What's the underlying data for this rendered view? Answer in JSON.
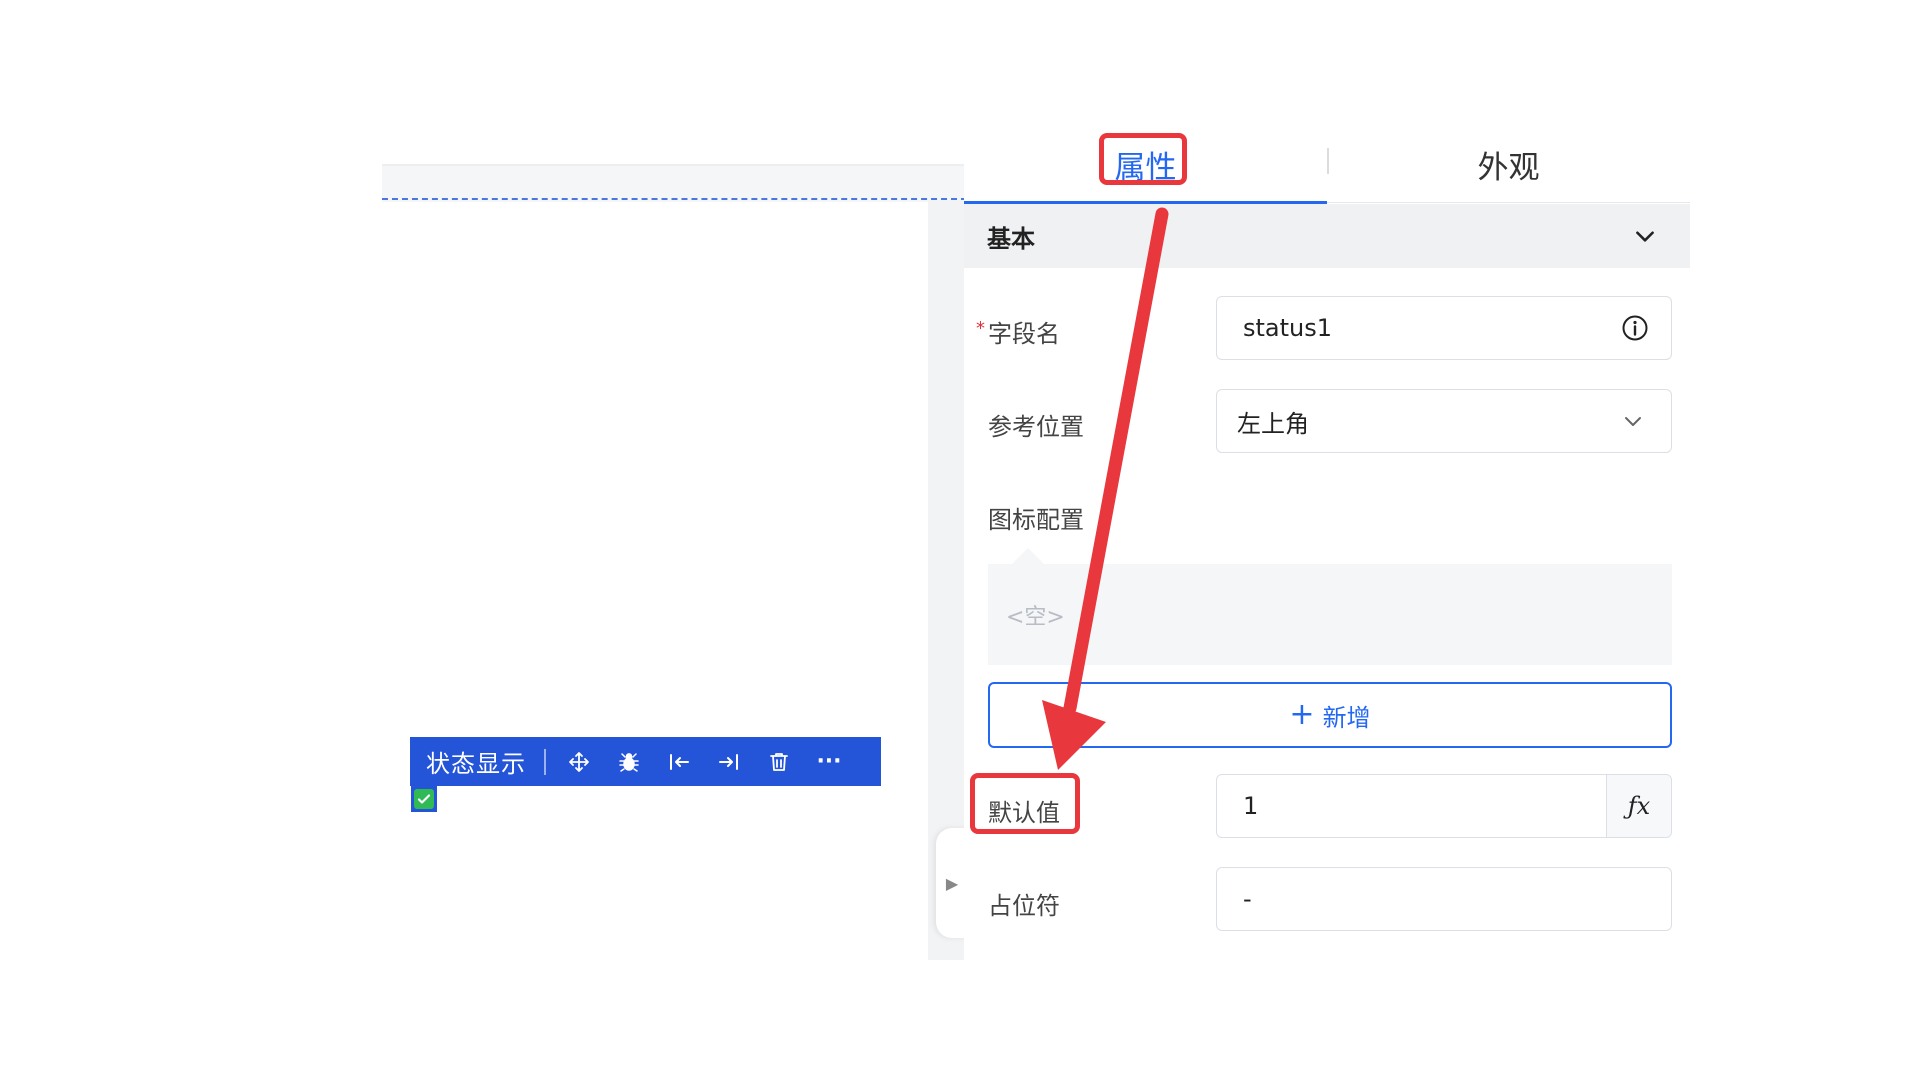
{
  "panel": {
    "tabs": [
      {
        "label": "属性",
        "active": true
      },
      {
        "label": "外观",
        "active": false
      }
    ],
    "section": {
      "title": "基本",
      "icon": "chevron-down-icon"
    },
    "fields": {
      "field_name": {
        "required_mark": "*",
        "label": "字段名",
        "value": "status1",
        "icon": "info-icon"
      },
      "ref_position": {
        "label": "参考位置",
        "value": "左上角",
        "icon": "chevron-down-icon"
      },
      "icon_config": {
        "label": "图标配置",
        "empty_text": "<空>",
        "add_label": "新增",
        "add_icon": "plus-icon"
      },
      "default_value": {
        "label": "默认值",
        "value": "1",
        "fx_label": "ƒx"
      },
      "placeholder": {
        "label": "占位符",
        "value": "-"
      }
    }
  },
  "widget": {
    "title": "状态显示",
    "toolbar_icons": [
      "move-icon",
      "bug-icon",
      "align-left-icon",
      "align-right-icon",
      "delete-icon",
      "more-icon"
    ],
    "more_label": "···"
  },
  "collapse_handle": {
    "icon": "triangle-right-icon",
    "glyph": "▶"
  },
  "colors": {
    "accent": "#2468f2",
    "toolbar": "#2454d8",
    "annotation": "#e8383d",
    "status_green": "#2fba56"
  }
}
